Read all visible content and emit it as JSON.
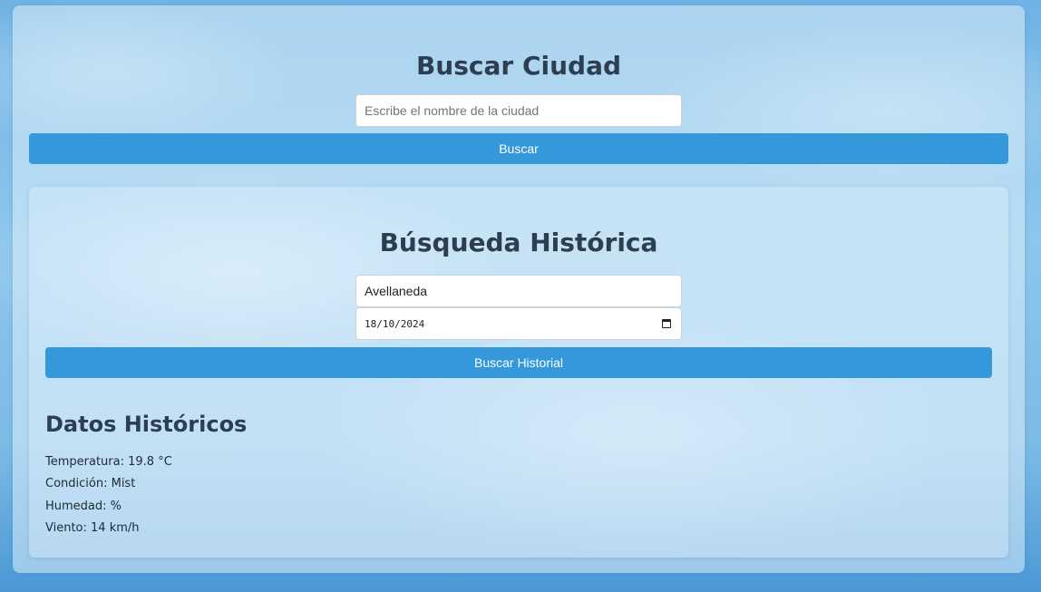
{
  "search": {
    "title": "Buscar Ciudad",
    "placeholder": "Escribe el nombre de la ciudad",
    "value": "",
    "button_label": "Buscar"
  },
  "history": {
    "title": "Búsqueda Histórica",
    "city_value": "Avellaneda",
    "date_value": "18/10/2024",
    "date_icon": "calendar-icon",
    "button_label": "Buscar Historial"
  },
  "results": {
    "title": "Datos Históricos",
    "temperature": "Temperatura: 19.8 °C",
    "condition": "Condición: Mist",
    "humidity": "Humedad: %",
    "wind": "Viento: 14 km/h"
  },
  "colors": {
    "accent": "#3498db",
    "heading": "#2c3e50"
  }
}
